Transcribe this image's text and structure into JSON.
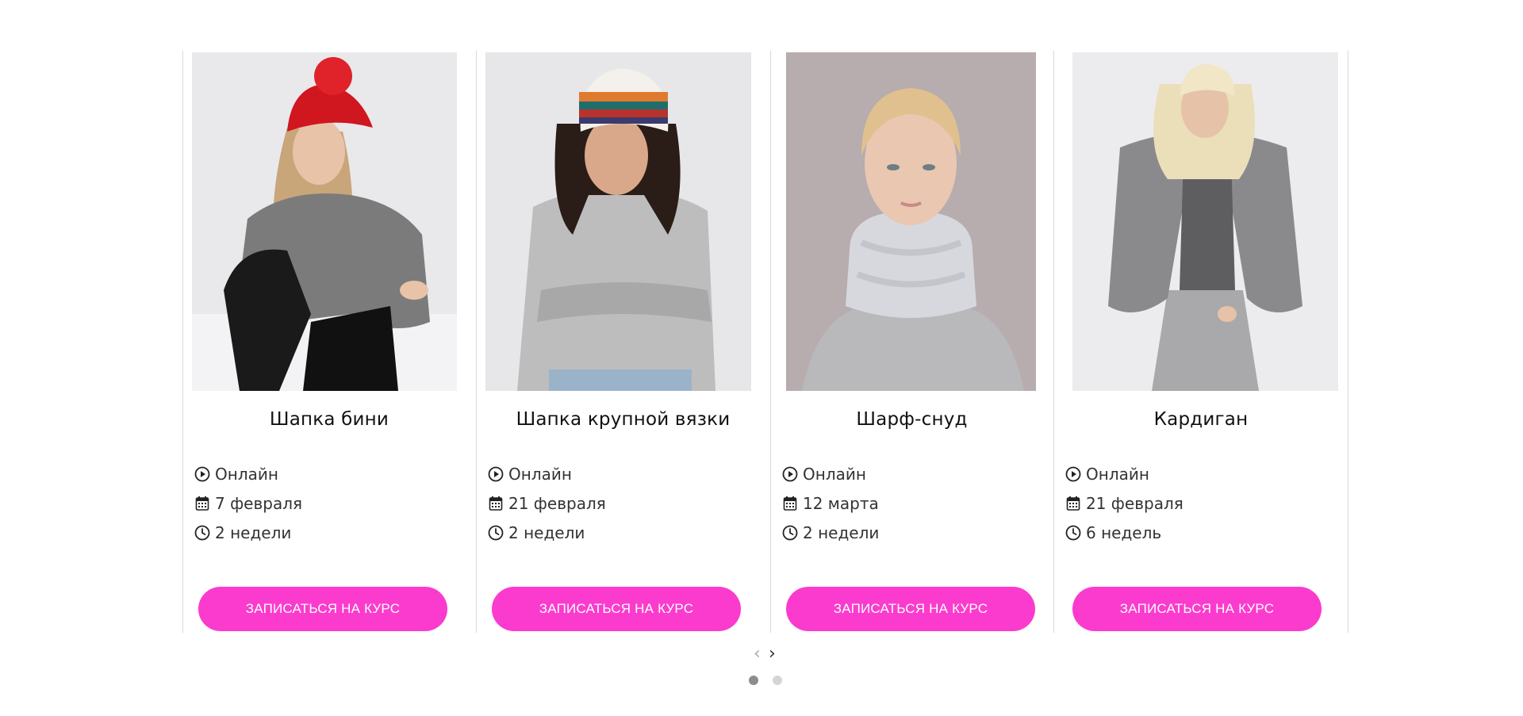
{
  "cards": [
    {
      "title": "Шапка бини",
      "format": "Онлайн",
      "date": "7 февраля",
      "duration": "2 недели",
      "cta": "ЗАПИСАТЬСЯ НА КУРС",
      "photo": "woman-red-pompom-beanie-photo"
    },
    {
      "title": "Шапка крупной вязки",
      "format": "Онлайн",
      "date": "21 февраля",
      "duration": "2 недели",
      "cta": "ЗАПИСАТЬСЯ НА КУРС",
      "photo": "woman-striped-chunky-hat-photo"
    },
    {
      "title": "Шарф-снуд",
      "format": "Онлайн",
      "date": "12 марта",
      "duration": "2 недели",
      "cta": "ЗАПИСАТЬСЯ НА КУРС",
      "photo": "woman-grey-snood-photo"
    },
    {
      "title": "Кардиган",
      "format": "Онлайн",
      "date": "21 февраля",
      "duration": "6 недель",
      "cta": "ЗАПИСАТЬСЯ НА КУРС",
      "photo": "woman-grey-cardigan-photo"
    }
  ],
  "carousel": {
    "prev": "‹",
    "next": "›",
    "pages": 2,
    "active_page": 1
  },
  "icons": {
    "format": "play-circle-icon",
    "date": "calendar-icon",
    "duration": "clock-icon"
  },
  "colors": {
    "accent": "#fb3bce",
    "text": "#222222",
    "divider": "#d9d9d9",
    "dot_active": "#8a8f8c",
    "dot_inactive": "#d5d5d5"
  }
}
